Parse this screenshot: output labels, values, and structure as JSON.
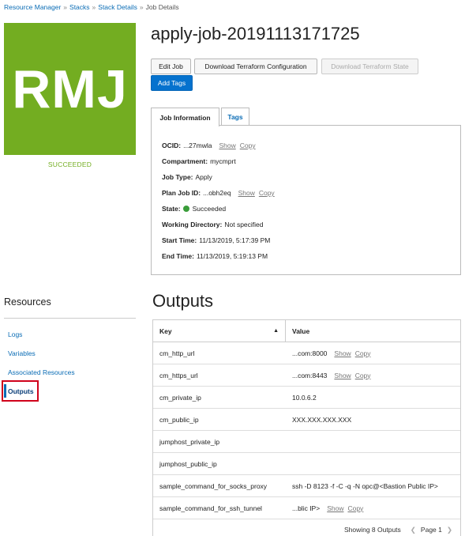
{
  "breadcrumb": {
    "items": [
      "Resource Manager",
      "Stacks",
      "Stack Details"
    ],
    "current": "Job Details",
    "separator": "»"
  },
  "tile": {
    "initials": "RMJ",
    "status": "SUCCEEDED",
    "color": "#73ad21"
  },
  "title": "apply-job-20191113171725",
  "buttons": {
    "edit": "Edit Job",
    "download_config": "Download Terraform Configuration",
    "download_state": "Download Terraform State",
    "add_tags": "Add Tags"
  },
  "tabs": {
    "info": "Job Information",
    "tags": "Tags"
  },
  "info": {
    "ocid_label": "OCID:",
    "ocid_value": "...27mwla",
    "compartment_label": "Compartment:",
    "compartment_value": "mycmprt",
    "job_type_label": "Job Type:",
    "job_type_value": "Apply",
    "plan_job_label": "Plan Job ID:",
    "plan_job_value": "...obh2eq",
    "state_label": "State:",
    "state_value": "Succeeded",
    "workdir_label": "Working Directory:",
    "workdir_value": "Not specified",
    "start_label": "Start Time:",
    "start_value": "11/13/2019, 5:17:39 PM",
    "end_label": "End Time:",
    "end_value": "11/13/2019, 5:19:13 PM",
    "show": "Show",
    "copy": "Copy"
  },
  "resources": {
    "title": "Resources",
    "items": [
      "Logs",
      "Variables",
      "Associated Resources",
      "Outputs"
    ]
  },
  "outputs": {
    "title": "Outputs",
    "col_key": "Key",
    "col_value": "Value",
    "rows": [
      {
        "key": "cm_http_url",
        "value": "...com:8000",
        "show": "Show",
        "copy": "Copy"
      },
      {
        "key": "cm_https_url",
        "value": "...com:8443",
        "show": "Show",
        "copy": "Copy"
      },
      {
        "key": "cm_private_ip",
        "value": "10.0.6.2"
      },
      {
        "key": "cm_public_ip",
        "value": " XXX.XXX.XXX.XXX"
      },
      {
        "key": "jumphost_private_ip",
        "value": ""
      },
      {
        "key": "jumphost_public_ip",
        "value": ""
      },
      {
        "key": "sample_command_for_socks_proxy",
        "value": "ssh -D 8123 -f -C -q -N opc@<Bastion Public IP>"
      },
      {
        "key": "sample_command_for_ssh_tunnel",
        "value": "...blic IP>",
        "show": "Show",
        "copy": "Copy"
      }
    ],
    "footer_count": "Showing 8 Outputs",
    "page_label": "Page 1"
  }
}
